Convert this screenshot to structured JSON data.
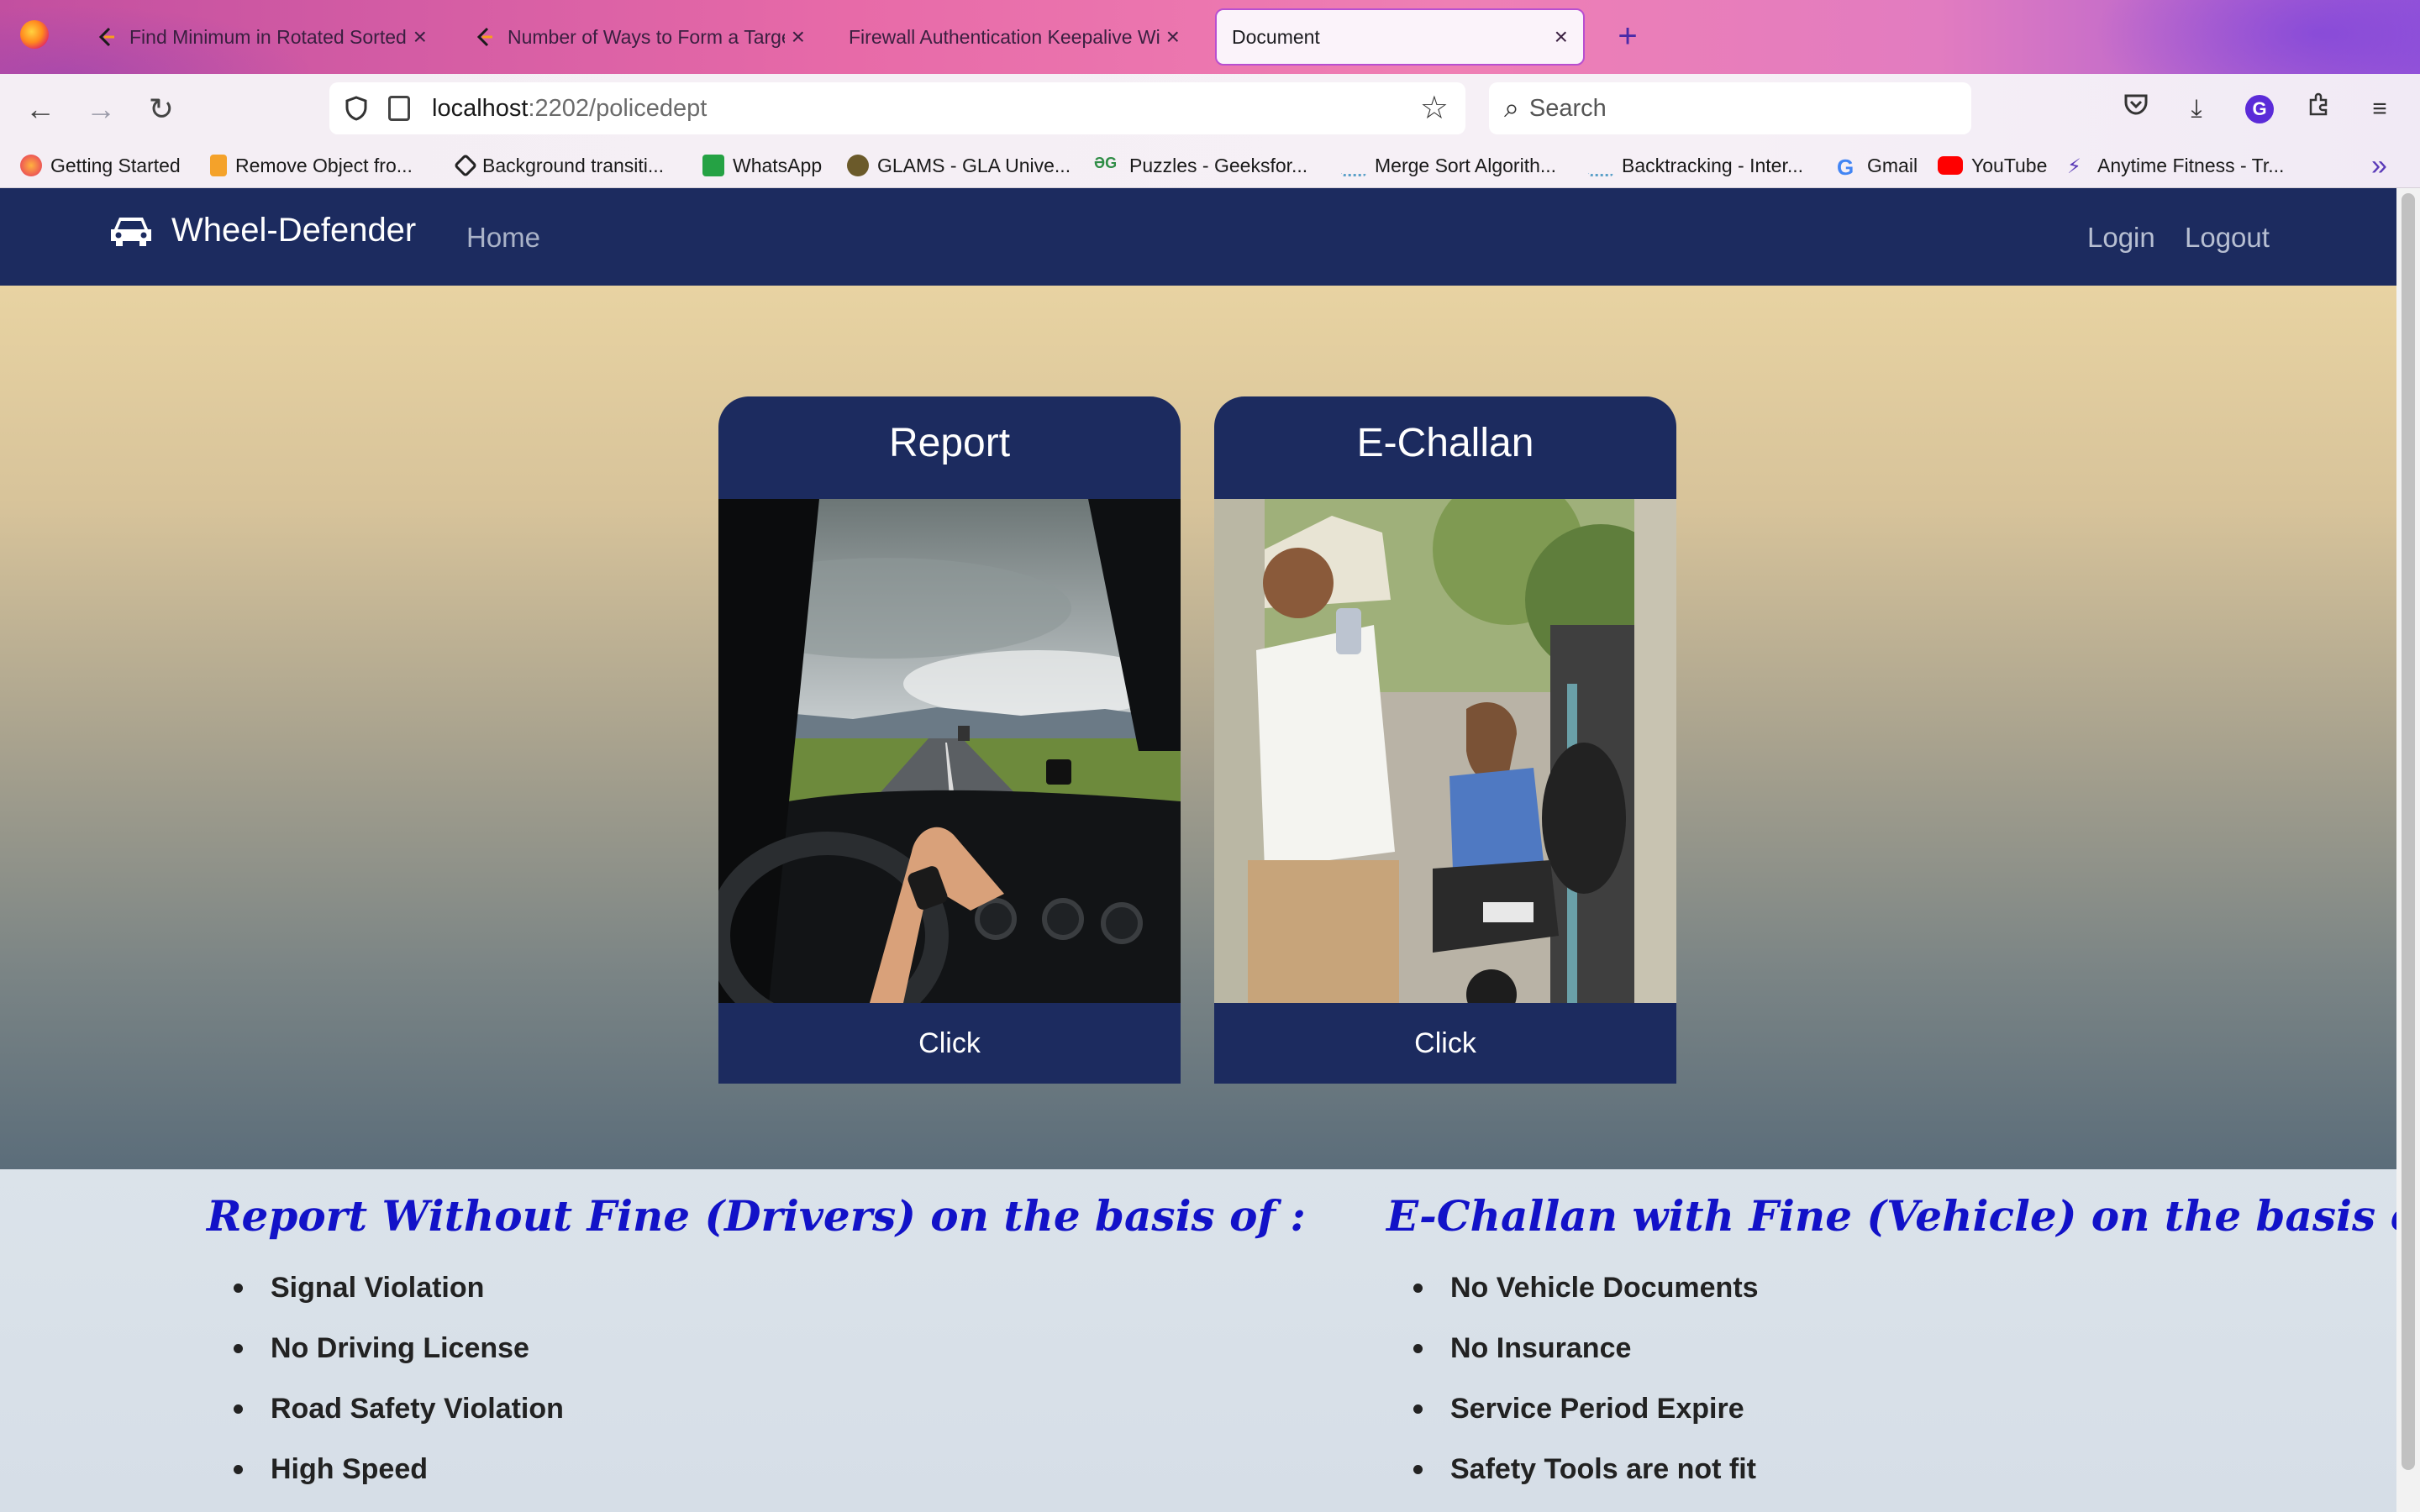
{
  "browser": {
    "tabs": [
      {
        "title": "Find Minimum in Rotated Sorted Array",
        "active": false
      },
      {
        "title": "Number of Ways to Form a Target String",
        "active": false
      },
      {
        "title": "Firewall Authentication Keepalive Window",
        "active": false
      },
      {
        "title": "Document",
        "active": true
      }
    ],
    "url_host": "localhost",
    "url_path": ":2202/policedept",
    "search_placeholder": "Search",
    "account_initial": "G",
    "bookmarks": [
      "Getting Started",
      "Remove Object fro...",
      "Background transiti...",
      "WhatsApp",
      "GLAMS - GLA Unive...",
      "Puzzles - Geeksfor...",
      "Merge Sort Algorith...",
      "Backtracking - Inter...",
      "Gmail",
      "YouTube",
      "Anytime Fitness - Tr..."
    ]
  },
  "site": {
    "brand": "Wheel-Defender",
    "nav_home": "Home",
    "nav_login": "Login",
    "nav_logout": "Logout",
    "nav_color": "#1c2b5f"
  },
  "cards": [
    {
      "title": "Report",
      "button": "Click"
    },
    {
      "title": "E-Challan",
      "button": "Click"
    }
  ],
  "info": {
    "left_heading": "Report Without Fine (Drivers) on the basis of :",
    "left_items": [
      "Signal Violation",
      "No Driving License",
      "Road Safety Violation",
      "High Speed"
    ],
    "right_heading": "E-Challan with Fine (Vehicle) on the basis of :",
    "right_items": [
      "No Vehicle Documents",
      "No Insurance",
      "Service Period Expire",
      "Safety Tools are not fit"
    ],
    "heading_color": "#1212c8"
  }
}
